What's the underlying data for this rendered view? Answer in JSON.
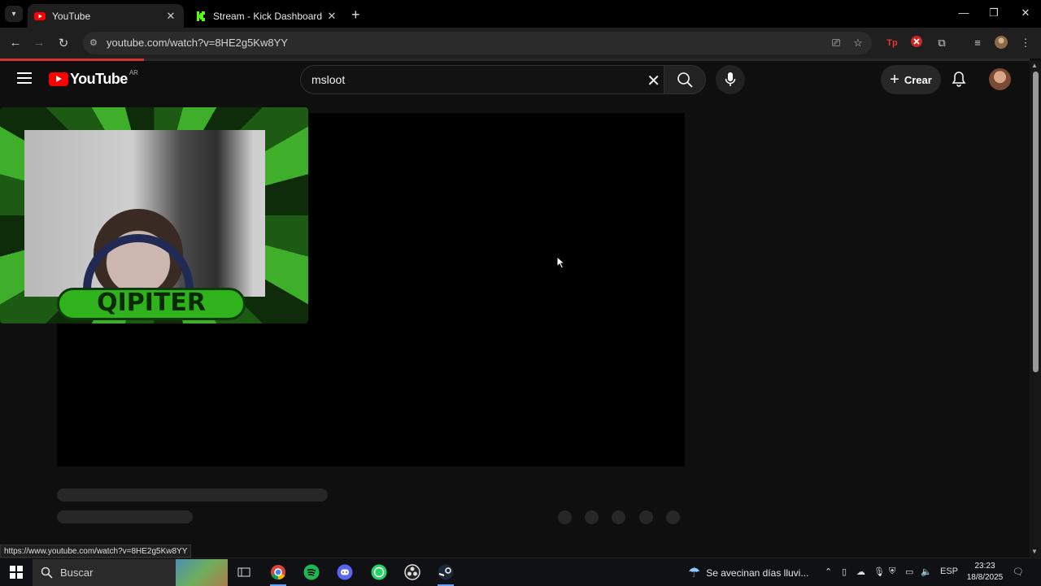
{
  "browser": {
    "tabs": [
      {
        "label": "YouTube",
        "active": true
      },
      {
        "label": "Stream - Kick Dashboard",
        "active": false
      }
    ],
    "url": "youtube.com/watch?v=8HE2g5Kw8YY",
    "status_url": "https://www.youtube.com/watch?v=8HE2g5Kw8YY",
    "page_load_progress": 0.14
  },
  "youtube": {
    "logo_text": "YouTube",
    "country_code": "AR",
    "search_query": "msloot",
    "create_label": "Crear"
  },
  "overlay": {
    "brand_text": "QIPITER"
  },
  "taskbar": {
    "search_placeholder": "Buscar",
    "weather_text": "Se avecinan días lluvi...",
    "language": "ESP",
    "time": "23:23",
    "date": "18/8/2025"
  },
  "colors": {
    "yt_red": "#ff0000",
    "page_bg": "#0f0f0f",
    "overlay_green": "#2fb21c",
    "kick_green": "#53fc18"
  }
}
